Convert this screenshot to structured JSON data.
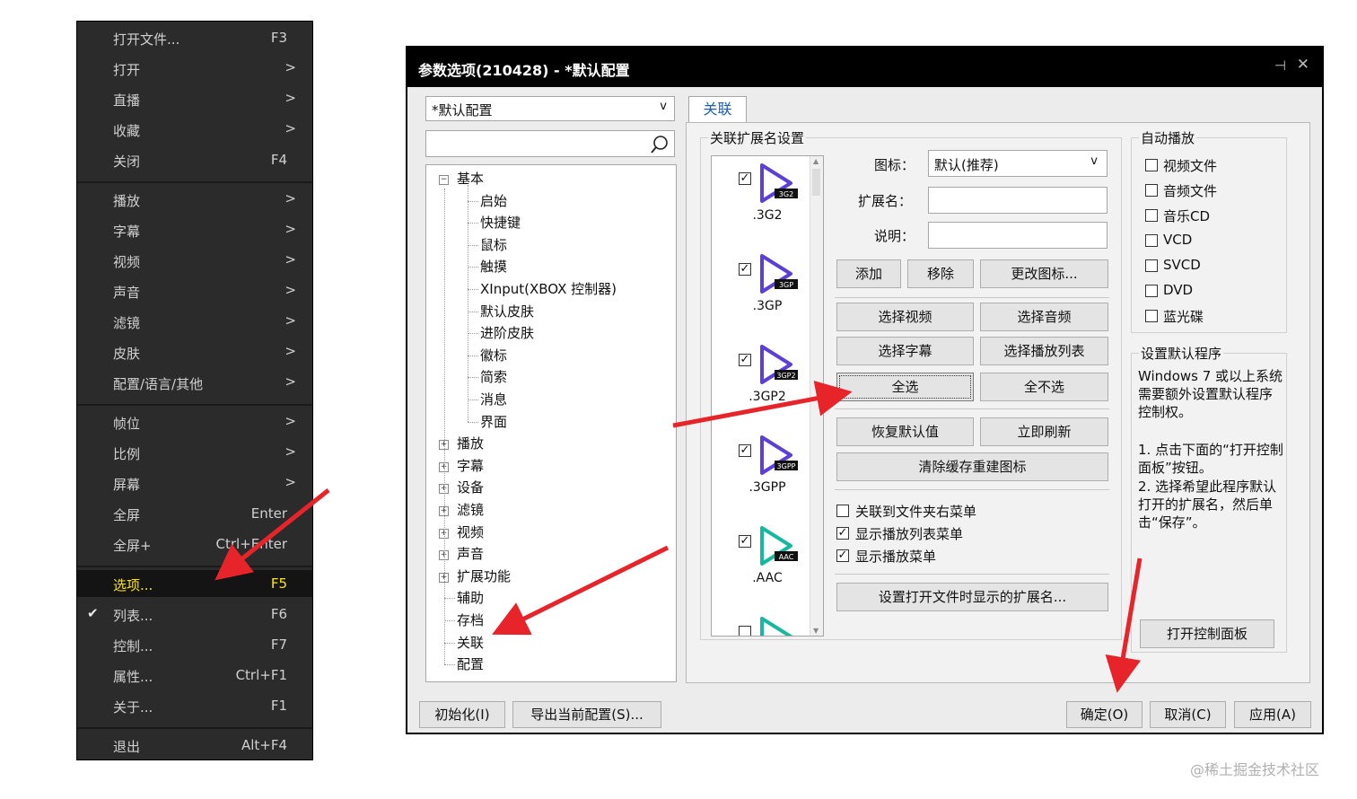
{
  "menu": {
    "items": [
      {
        "label": "打开文件...",
        "shortcut": "F3",
        "arrow": ""
      },
      {
        "label": "打开",
        "shortcut": "",
        "arrow": ">"
      },
      {
        "label": "直播",
        "shortcut": "",
        "arrow": ">"
      },
      {
        "label": "收藏",
        "shortcut": "",
        "arrow": ">"
      },
      {
        "label": "关闭",
        "shortcut": "F4",
        "arrow": ""
      },
      {
        "label": "播放",
        "shortcut": "",
        "arrow": ">"
      },
      {
        "label": "字幕",
        "shortcut": "",
        "arrow": ">"
      },
      {
        "label": "视频",
        "shortcut": "",
        "arrow": ">"
      },
      {
        "label": "声音",
        "shortcut": "",
        "arrow": ">"
      },
      {
        "label": "滤镜",
        "shortcut": "",
        "arrow": ">"
      },
      {
        "label": "皮肤",
        "shortcut": "",
        "arrow": ">"
      },
      {
        "label": "配置/语言/其他",
        "shortcut": "",
        "arrow": ">"
      },
      {
        "label": "帧位",
        "shortcut": "",
        "arrow": ">"
      },
      {
        "label": "比例",
        "shortcut": "",
        "arrow": ">"
      },
      {
        "label": "屏幕",
        "shortcut": "",
        "arrow": ">"
      },
      {
        "label": "全屏",
        "shortcut": "Enter",
        "arrow": ""
      },
      {
        "label": "全屏+",
        "shortcut": "Ctrl+Enter",
        "arrow": ""
      },
      {
        "label": "选项...",
        "shortcut": "F5",
        "arrow": ""
      },
      {
        "label": "列表...",
        "shortcut": "F6",
        "arrow": "",
        "check": "✔"
      },
      {
        "label": "控制...",
        "shortcut": "F7",
        "arrow": ""
      },
      {
        "label": "属性...",
        "shortcut": "Ctrl+F1",
        "arrow": ""
      },
      {
        "label": "关于...",
        "shortcut": "F1",
        "arrow": ""
      },
      {
        "label": "退出",
        "shortcut": "Alt+F4",
        "arrow": ""
      }
    ]
  },
  "dialog": {
    "title": "参数选项(210428) - *默认配置",
    "pin_glyph": "⊣",
    "close_glyph": "✕",
    "config_select": "*默认配置",
    "search_placeholder": "",
    "tree": {
      "root": "基本",
      "basic_children": [
        "启始",
        "快捷键",
        "鼠标",
        "触摸",
        "XInput(XBOX 控制器)",
        "默认皮肤",
        "进阶皮肤",
        "徽标",
        "简索",
        "消息",
        "界面"
      ],
      "collapsed": [
        "播放",
        "字幕",
        "设备",
        "滤镜",
        "视频",
        "声音",
        "扩展功能"
      ],
      "leaves": [
        "辅助",
        "存档",
        "关联",
        "配置"
      ]
    },
    "tab": "关联",
    "assoc_group": "关联扩展名设置",
    "extensions": [
      {
        "name": ".3G2",
        "badge": "3G2",
        "color": "#5b3fd6"
      },
      {
        "name": ".3GP",
        "badge": "3GP",
        "color": "#5b3fd6"
      },
      {
        "name": ".3GP2",
        "badge": "3GP2",
        "color": "#5b3fd6"
      },
      {
        "name": ".3GPP",
        "badge": "3GPP",
        "color": "#5b3fd6"
      },
      {
        "name": ".AAC",
        "badge": "AAC",
        "color": "#16b8a0"
      }
    ],
    "icon_label": "图标：",
    "icon_value": "默认(推荐)",
    "ext_label": "扩展名：",
    "desc_label": "说明：",
    "buttons": {
      "add": "添加",
      "remove": "移除",
      "change_icon": "更改图标...",
      "sel_video": "选择视频",
      "sel_audio": "选择音频",
      "sel_sub": "选择字幕",
      "sel_playlist": "选择播放列表",
      "select_all": "全选",
      "select_none": "全不选",
      "restore": "恢复默认值",
      "refresh": "立即刷新",
      "rebuild": "清除缓存重建图标",
      "set_ext": "设置打开文件时显示的扩展名..."
    },
    "checks": [
      {
        "label": "关联到文件夹右菜单",
        "checked": false
      },
      {
        "label": "显示播放列表菜单",
        "checked": true
      },
      {
        "label": "显示播放菜单",
        "checked": true
      }
    ],
    "autoplay": {
      "title": "自动播放",
      "items": [
        "视频文件",
        "音频文件",
        "音乐CD",
        "VCD",
        "SVCD",
        "DVD",
        "蓝光碟"
      ]
    },
    "default_prog": {
      "title": "设置默认程序",
      "text1": "Windows 7 或以上系统需要额外设置默认程序控制权。",
      "text2": "1. 点击下面的“打开控制面板”按钮。",
      "text3": "2. 选择希望此程序默认打开的扩展名，然后单击“保存”。",
      "button": "打开控制面板"
    },
    "footer": {
      "init": "初始化(I)",
      "export": "导出当前配置(S)...",
      "ok": "确定(O)",
      "cancel": "取消(C)",
      "apply": "应用(A)"
    }
  },
  "watermark": "@稀土掘金技术社区",
  "colors": {
    "arrow": "#e8242b",
    "menu_bg": "#2b2b2b",
    "menu_highlight": "#ffe600",
    "tab_text": "#1a5fb4"
  }
}
